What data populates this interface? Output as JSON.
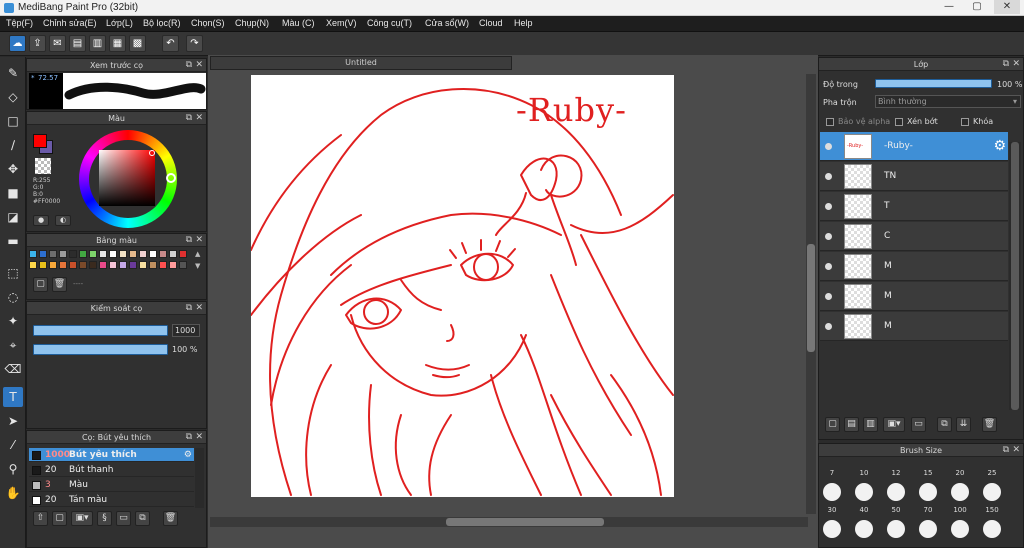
{
  "window": {
    "title": "MediBang Paint Pro (32bit)",
    "min": "—",
    "max": "▢",
    "close": "✕"
  },
  "menu": [
    "Tệp(F)",
    "Chỉnh sửa(E)",
    "Lớp(L)",
    "Bộ lọc(R)",
    "Chọn(S)",
    "Chụp(N)",
    "Màu (C)",
    "Xem(V)",
    "Công cụ(T)",
    "Cửa sổ(W)",
    "Cloud",
    "Help"
  ],
  "panels": {
    "brush_preview": {
      "title": "Xem trước cọ",
      "size": "72.57"
    },
    "color": {
      "title": "Màu",
      "r": "R:255",
      "g": "G:0",
      "b": "B:0",
      "hex": "#FF0000",
      "primary": "#ff0000",
      "secondary": "#6a5aa8"
    },
    "palette": {
      "title": "Bảng màu",
      "dash": "----",
      "colors": [
        "#3bb4ea",
        "#2d6fd0",
        "#6d6d6d",
        "#9a9a9a",
        "#2c2c2c",
        "#42a842",
        "#7ed36b",
        "#e6e6e6",
        "#ffffff",
        "#f2e2c6",
        "#e4b98c",
        "#f0d0d0",
        "#ffffff",
        "#c98a8a",
        "#d0d0d0",
        "#e03030",
        "#ffd84a",
        "#e8c01a",
        "#f7a83a",
        "#e6753a",
        "#c8502a",
        "#7a4a2a",
        "#3a2a1e",
        "#e94a8a",
        "#f5c4d8",
        "#c4a8e8",
        "#6a3a9a",
        "#f7e0a0",
        "#c09060",
        "#ff5050",
        "#ff9a9a",
        "#555555"
      ]
    },
    "brush_control": {
      "title": "Kiểm soát cọ",
      "size": "1000",
      "opacity": "100 %"
    },
    "brushes": {
      "title": "Cọ: Bút yêu thích",
      "items": [
        {
          "num": "1000",
          "name": "Bút yêu thích",
          "box": "#1a1a1a"
        },
        {
          "num": "20",
          "name": "Bút thanh",
          "box": "#1a1a1a"
        },
        {
          "num": "3",
          "name": "Màu",
          "box": "#bdbdbd"
        },
        {
          "num": "20",
          "name": "Tán màu",
          "box": "#ffffff"
        }
      ]
    }
  },
  "document": {
    "tab": "Untitled",
    "text": "-Ruby-",
    "stroke": "#e02020"
  },
  "layers": {
    "title": "Lớp",
    "opacity_label": "Độ trong",
    "opacity_value": "100 %",
    "blend_label": "Pha trộn",
    "blend_value": "Bình thường",
    "alpha_protect": "Bảo vệ alpha",
    "clip": "Xén bớt",
    "lock": "Khóa",
    "items": [
      {
        "name": "-Ruby-"
      },
      {
        "name": "TN"
      },
      {
        "name": "T"
      },
      {
        "name": "C"
      },
      {
        "name": "M"
      },
      {
        "name": "M"
      },
      {
        "name": "M"
      }
    ]
  },
  "brush_size": {
    "title": "Brush Size",
    "row1": [
      "7",
      "10",
      "12",
      "15",
      "20",
      "25"
    ],
    "row2": [
      "30",
      "40",
      "50",
      "70",
      "100",
      "150"
    ]
  }
}
